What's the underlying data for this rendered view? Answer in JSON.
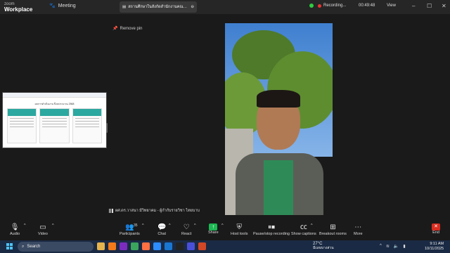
{
  "titlebar": {
    "logo_top": "zoom",
    "logo_bottom": "Workplace",
    "meeting_tab": "Meeting",
    "shared_tab_title": "สถานศึกษาในสังกัดสำนักงานคณะกรรมการส่งเสริมการศึกษาเอกชน",
    "recording_label": "Recording...",
    "timer": "00:49:48",
    "view_label": "View"
  },
  "stage": {
    "remove_pin": "Remove pin",
    "shared_doc_title": "ผลการดำเนินงาน ปีงบประมาณ 2568",
    "participant_name": "ผศ.ดร.วาสนา มีวิทยาคม - ผู้กำกับรายวิชา ไทยบาบ"
  },
  "toolbar": {
    "audio": "Audio",
    "video": "Video",
    "participants": "Participants",
    "participants_count": "35",
    "chat": "Chat",
    "react": "React",
    "share": "Share",
    "host_tools": "Host tools",
    "pause_recording": "Pause/stop recording",
    "captions": "Show captions",
    "breakout": "Breakout rooms",
    "more": "More",
    "end": "End"
  },
  "taskbar": {
    "search_placeholder": "Search",
    "temperature": "27°C",
    "weather_desc": "มีเมฆบางส่วน",
    "time": "9:11 AM",
    "date": "10/11/2025"
  },
  "colors": {
    "share_green": "#1db954",
    "end_red": "#d92d20",
    "record_red": "#e33333"
  }
}
